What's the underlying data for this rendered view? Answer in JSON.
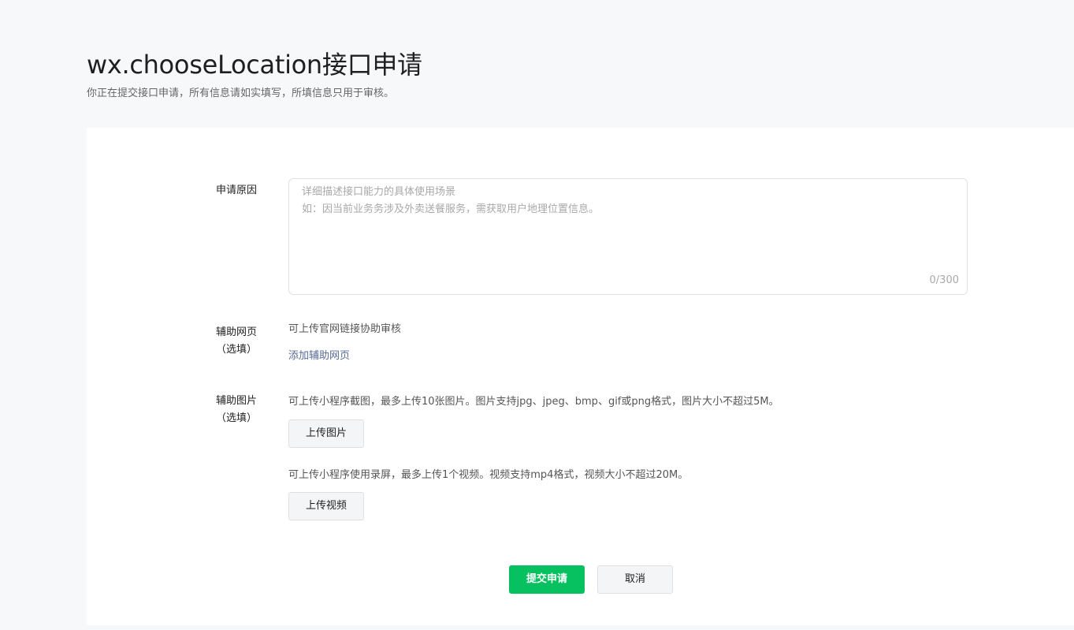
{
  "header": {
    "title": "wx.chooseLocation接口申请",
    "subtitle": "你正在提交接口申请，所有信息请如实填写，所填信息只用于审核。"
  },
  "form": {
    "reason": {
      "label": "申请原因",
      "placeholder": "详细描述接口能力的具体使用场景\n如：因当前业务务涉及外卖送餐服务，需获取用户地理位置信息。",
      "value": "",
      "counter": "0/300"
    },
    "helper_page": {
      "label_line1": "辅助网页",
      "label_line2": "（选填）",
      "hint": "可上传官网链接协助审核",
      "add_link": "添加辅助网页"
    },
    "helper_image": {
      "label_line1": "辅助图片",
      "label_line2": "（选填）",
      "image_hint": "可上传小程序截图，最多上传10张图片。图片支持jpg、jpeg、bmp、gif或png格式，图片大小不超过5M。",
      "upload_image_label": "上传图片",
      "video_hint": "可上传小程序使用录屏，最多上传1个视频。视频支持mp4格式，视频大小不超过20M。",
      "upload_video_label": "上传视频"
    }
  },
  "actions": {
    "submit_label": "提交申请",
    "cancel_label": "取消"
  },
  "colors": {
    "primary": "#07c160",
    "link": "#576b95",
    "page_background": "#f7f8fa"
  }
}
